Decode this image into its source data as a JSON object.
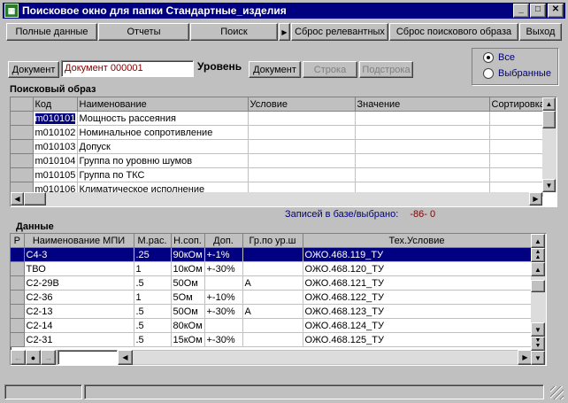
{
  "window": {
    "title": "Поисковое окно для папки Стандартные_изделия"
  },
  "toolbar": {
    "full_data": "Полные данные",
    "reports": "Отчеты",
    "search": "Поиск",
    "arrow": "▶",
    "reset_relevant": "Сброс релевантных",
    "reset_search_image": "Сброс поискового образа",
    "exit": "Выход"
  },
  "filter": {
    "doc_label": "Документ",
    "doc_value": "Документ 000001",
    "level_label": "Уровень",
    "level_doc": "Документ",
    "level_row": "Строка",
    "level_subrow": "Подстрока",
    "all_label": "Все",
    "selected_label": "Выбранные"
  },
  "search_image": {
    "section_title": "Поисковый образ",
    "headers": [
      "Код",
      "Наименование",
      "Условие",
      "Значение",
      "Сортировка"
    ],
    "rows": [
      {
        "code": "m010101",
        "name": "Мощность рассеяния"
      },
      {
        "code": "m010102",
        "name": "Номинальное сопротивление"
      },
      {
        "code": "m010103",
        "name": "Допуск"
      },
      {
        "code": "m010104",
        "name": "Группа по уровню шумов"
      },
      {
        "code": "m010105",
        "name": "Группа по ТКС"
      },
      {
        "code": "m010106",
        "name": "Климатическое исполнение"
      }
    ]
  },
  "records": {
    "label": "Записей в базе/выбрано:",
    "value": "-86- 0"
  },
  "data_table": {
    "section_title": "Данные",
    "headers": [
      "Р",
      "Наименование МПИ",
      "М.рас.",
      "Н.соп.",
      "Доп.",
      "Гр.по ур.ш",
      "Тех.Условие"
    ],
    "rows": [
      {
        "name": "С4-3",
        "power": ".25",
        "res": "90кОм",
        "tol": "+-1%",
        "grp": "",
        "tu": "ОЖО.468.119_ТУ"
      },
      {
        "name": "ТВО",
        "power": "1",
        "res": "10кОм",
        "tol": "+-30%",
        "grp": "",
        "tu": "ОЖО.468.120_ТУ"
      },
      {
        "name": "С2-29В",
        "power": ".5",
        "res": "50Ом",
        "tol": "",
        "grp": "А",
        "tu": "ОЖО.468.121_ТУ"
      },
      {
        "name": "С2-36",
        "power": "1",
        "res": "5Ом",
        "tol": "+-10%",
        "grp": "",
        "tu": "ОЖО.468.122_ТУ"
      },
      {
        "name": "С2-13",
        "power": ".5",
        "res": "50Ом",
        "tol": "+-30%",
        "grp": "А",
        "tu": "ОЖО.468.123_ТУ"
      },
      {
        "name": "С2-14",
        "power": ".5",
        "res": "80кОм",
        "tol": "",
        "grp": "",
        "tu": "ОЖО.468.124_ТУ"
      },
      {
        "name": "С2-31",
        "power": ".5",
        "res": "15кОм",
        "tol": "+-30%",
        "grp": "",
        "tu": "ОЖО.468.125_ТУ"
      }
    ]
  },
  "colors": {
    "titlebar": "#000080",
    "selection": "#000080",
    "records_label": "#000080",
    "records_value": "#800000",
    "doc_value": "#800000"
  }
}
